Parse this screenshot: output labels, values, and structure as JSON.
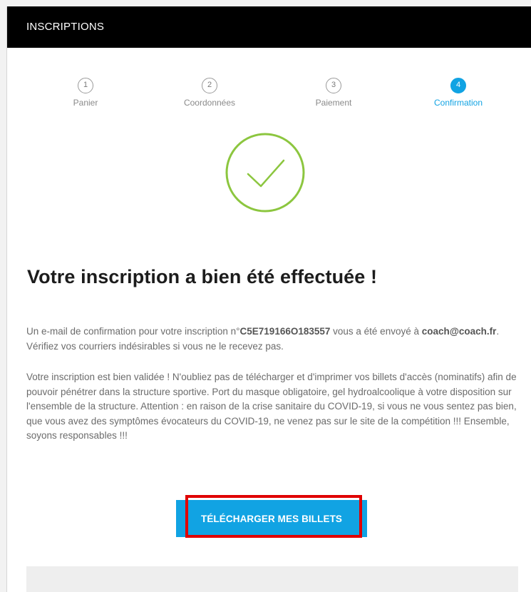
{
  "header": {
    "title": "INSCRIPTIONS"
  },
  "steps": [
    {
      "number": "1",
      "label": "Panier",
      "state": "done"
    },
    {
      "number": "2",
      "label": "Coordonnées",
      "state": "done"
    },
    {
      "number": "3",
      "label": "Paiement",
      "state": "done"
    },
    {
      "number": "4",
      "label": "Confirmation",
      "state": "active"
    }
  ],
  "confirmation": {
    "icon": "check-circle-icon",
    "icon_color": "#8cc63f",
    "title": "Votre inscription a bien été effectuée !",
    "paragraph1": {
      "part1": "Un e-mail de confirmation pour votre inscription n°",
      "registration_number": "C5E719166O183557",
      "part2": " vous a été envoyé à ",
      "email": "coach@coach.fr",
      "part3": ". Vérifiez vos courriers indésirables si vous ne le recevez pas."
    },
    "paragraph2": "Votre inscription est bien validée ! N'oubliez pas de télécharger et d'imprimer vos billets d'accès (nominatifs) afin de pouvoir pénétrer dans la structure sportive. Port du masque obligatoire, gel hydroalcoolique à votre disposition sur l'ensemble de la structure. Attention : en raison de la crise sanitaire du COVID-19, si vous ne vous sentez pas bien, que vous avez des symptômes évocateurs du COVID-19, ne venez pas sur le site de la compétition !!! Ensemble, soyons responsables !!!"
  },
  "download_button": {
    "label": "TÉLÉCHARGER MES BILLETS",
    "highlighted": true
  },
  "colors": {
    "accent": "#11a3e3",
    "header_bg": "#000000",
    "success": "#8cc63f",
    "highlight": "#e00000"
  }
}
